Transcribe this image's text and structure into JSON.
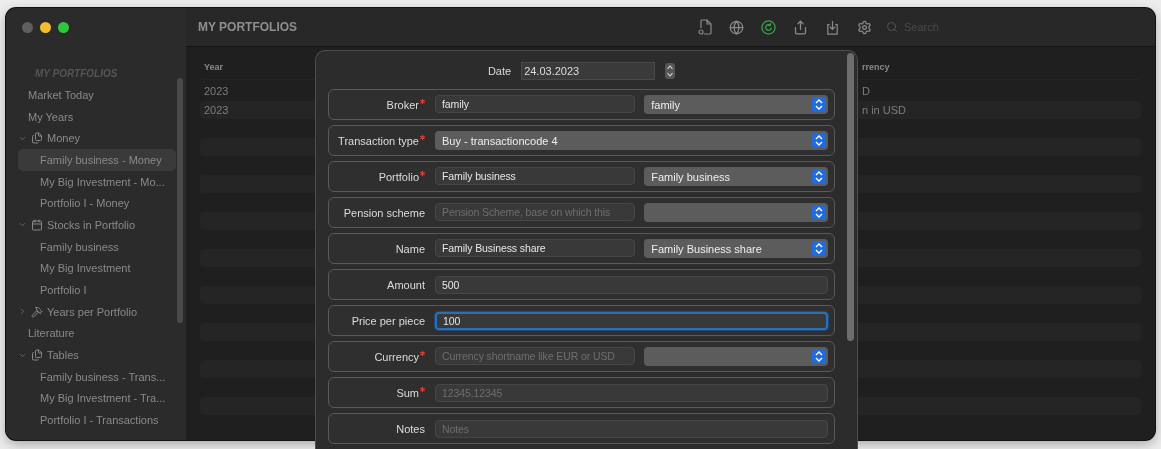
{
  "window": {
    "title": "MY PORTFOLIOS"
  },
  "toolbar": {
    "search": {
      "placeholder": "Search"
    }
  },
  "sidebar": {
    "heading": "MY PORTFOLIOS",
    "items": [
      {
        "label": "Market Today",
        "selected": false
      },
      {
        "label": "My Years",
        "selected": false
      },
      {
        "label": "Money",
        "selected": false,
        "expanded": true,
        "children": [
          {
            "label": "Family business - Money",
            "selected": true
          },
          {
            "label": "My Big Investment - Mo...",
            "selected": false
          },
          {
            "label": "Portfolio I - Money",
            "selected": false
          }
        ]
      },
      {
        "label": "Stocks in Portfolio",
        "selected": false,
        "expanded": true,
        "children": [
          {
            "label": "Family business",
            "selected": false
          },
          {
            "label": "My Big Investment",
            "selected": false
          },
          {
            "label": "Portfolio I",
            "selected": false
          }
        ]
      },
      {
        "label": "Years per Portfolio",
        "selected": false,
        "expanded": false
      },
      {
        "label": "Literature",
        "selected": false
      },
      {
        "label": "Tables",
        "selected": false,
        "expanded": true,
        "children": [
          {
            "label": "Family business - Trans...",
            "selected": false
          },
          {
            "label": "My Big Investment - Tra...",
            "selected": false
          },
          {
            "label": "Portfolio I - Transactions",
            "selected": false
          }
        ]
      }
    ]
  },
  "table": {
    "columns": [
      "Year",
      "rrency"
    ],
    "rows": [
      [
        "2023",
        "D"
      ],
      [
        "2023",
        "n in USD"
      ]
    ]
  },
  "sheet": {
    "date": {
      "label": "Date",
      "value": "24.03.2023"
    },
    "rows": [
      {
        "kind": "text_select",
        "label": "Broker",
        "required": true,
        "focused": false,
        "value": "family",
        "option": "family"
      },
      {
        "kind": "select",
        "label": "Transaction type",
        "required": true,
        "focused": false,
        "option": "Buy - transactioncode 4"
      },
      {
        "kind": "text_select",
        "label": "Portfolio",
        "required": true,
        "focused": false,
        "value": "Family business",
        "option": "Family business"
      },
      {
        "kind": "text_select",
        "label": "Pension scheme",
        "required": false,
        "focused": false,
        "placeholder": "Pension Scheme, base on which this"
      },
      {
        "kind": "text_select",
        "label": "Name",
        "required": false,
        "focused": false,
        "value": "Family Business share",
        "option": "Family Business share"
      },
      {
        "kind": "text",
        "label": "Amount",
        "required": false,
        "focused": false,
        "value": "500"
      },
      {
        "kind": "text",
        "label": "Price per piece",
        "required": false,
        "focused": true,
        "value": "100"
      },
      {
        "kind": "text_select",
        "label": "Currency",
        "required": true,
        "focused": false,
        "placeholder": "Currency shortname like EUR or USD"
      },
      {
        "kind": "text",
        "label": "Sum",
        "required": true,
        "focused": false,
        "placeholder": "12345.12345"
      },
      {
        "kind": "text",
        "label": "Notes",
        "required": false,
        "focused": false,
        "placeholder": "Notes"
      }
    ]
  }
}
